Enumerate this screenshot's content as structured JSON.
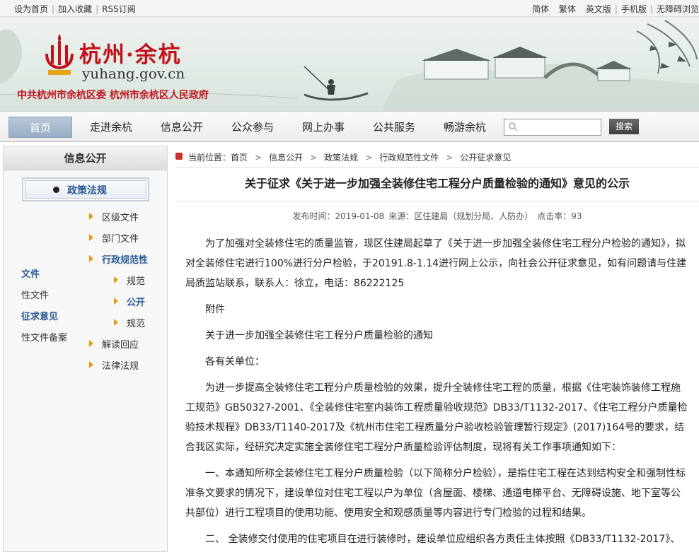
{
  "topbar": {
    "left_links": [
      "设为首页",
      "加入收藏",
      "RSS订阅"
    ],
    "right_links": [
      "简体",
      "繁体",
      "英文版",
      "手机版",
      "无障碍浏览"
    ]
  },
  "banner": {
    "logo_cn": "杭州·余杭",
    "logo_en": "yuhang.gov.cn",
    "subtitle": "中共杭州市余杭区委  杭州市余杭区人民政府"
  },
  "nav": {
    "items": [
      "首页",
      "走进余杭",
      "信息公开",
      "公众参与",
      "网上办事",
      "公共服务",
      "畅游余杭"
    ],
    "search_placeholder": "",
    "search_button": "搜索"
  },
  "sidebar": {
    "title": "信息公开",
    "category": "政策法规",
    "links": [
      "区级文件",
      "部门文件",
      "行政规范性",
      "文件",
      "性文件",
      "规范",
      "公开",
      "征求意见",
      "规范",
      "性文件备案",
      "解读回应",
      "法律法规"
    ]
  },
  "breadcrumb": {
    "prefix": "当前位置：",
    "items": [
      "首页",
      "信息公开",
      "政策法规",
      "行政规范性文件",
      "公开征求意见"
    ]
  },
  "article": {
    "title": "关于征求《关于进一步加强全装修住宅工程分户质量检验的通知》意见的公示",
    "meta_date": "发布时间：2019-01-08",
    "meta_source": "来源：区住建局（规划分局、人防办）",
    "meta_hits": "点击率：93",
    "paragraphs": [
      "为了加强对全装修住宅的质量监管，现区住建局起草了《关于进一步加强全装修住宅工程分户检验的通知》，拟对全装修住宅进行100%进行分户检验，于20191.8-1.14进行网上公示，向社会公开征求意见，如有问题请与住建局质监站联系，联系人：徐立，电话：86222125",
      "附件",
      "关于进一步加强全装修住宅工程分户质量检验的通知",
      "各有关单位：",
      "为进一步提高全装修住宅工程分户质量检验的效果，提升全装修住宅工程的质量，根据《住宅装饰装修工程施工规范》GB50327-2001、《全装修住宅室内装饰工程质量验收规范》DB33/T1132-2017、《住宅工程分户质量检验技术规程》DB33/T1140-2017及《杭州市住宅工程质量分户验收检验管理暂行规定》(2017)164号的要求，结合我区实际，经研究决定实施全装修住宅工程分户质量检验评估制度，现将有关工作事项通知如下：",
      "一、本通知所称全装修住宅工程分户质量检验（以下简称分户检验），是指住宅工程在达到结构安全和强制性标准条文要求的情况下，建设单位对住宅工程以户为单位（含屋面、楼梯、通道电梯平台、无障碍设施、地下室等公共部位）进行工程项目的使用功能、使用安全和观感质量等内容进行专门检验的过程和结果。",
      "二、  全装修交付使用的住宅项目在进行装修时，建设单位应组织各方责任主体按照《DB33/T1132-2017》、"
    ]
  }
}
